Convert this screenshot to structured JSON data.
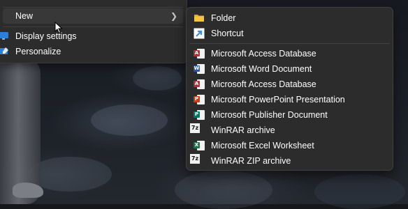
{
  "context_menu": {
    "items": [
      {
        "label": "New",
        "has_submenu": true
      },
      {
        "label": "Display settings",
        "icon": "display-icon"
      },
      {
        "label": "Personalize",
        "icon": "personalize-icon"
      }
    ]
  },
  "new_submenu": {
    "top_items": [
      {
        "label": "Folder",
        "icon": "folder-icon"
      },
      {
        "label": "Shortcut",
        "icon": "shortcut-icon"
      }
    ],
    "file_items": [
      {
        "label": "Microsoft Access Database",
        "icon": "access-icon",
        "badge": "A",
        "color": "#a4373a"
      },
      {
        "label": "Microsoft Word Document",
        "icon": "word-icon",
        "badge": "W",
        "color": "#2b579a"
      },
      {
        "label": "Microsoft Access Database",
        "icon": "access-icon",
        "badge": "A",
        "color": "#a4373a"
      },
      {
        "label": "Microsoft PowerPoint Presentation",
        "icon": "powerpoint-icon",
        "badge": "P",
        "color": "#c43e1c"
      },
      {
        "label": "Microsoft Publisher Document",
        "icon": "publisher-icon",
        "badge": "P",
        "color": "#077568"
      },
      {
        "label": "WinRAR archive",
        "icon": "winrar-icon",
        "badge": "7z"
      },
      {
        "label": "Microsoft Excel Worksheet",
        "icon": "excel-icon",
        "badge": "X",
        "color": "#217346"
      },
      {
        "label": "WinRAR ZIP archive",
        "icon": "winrar-zip-icon",
        "badge": "7z"
      }
    ]
  },
  "colors": {
    "menu_bg": "#2c2c2c",
    "hover_bg": "#383838",
    "folder": "#f6c445",
    "shortcut_arrow": "#3f8ee0"
  }
}
